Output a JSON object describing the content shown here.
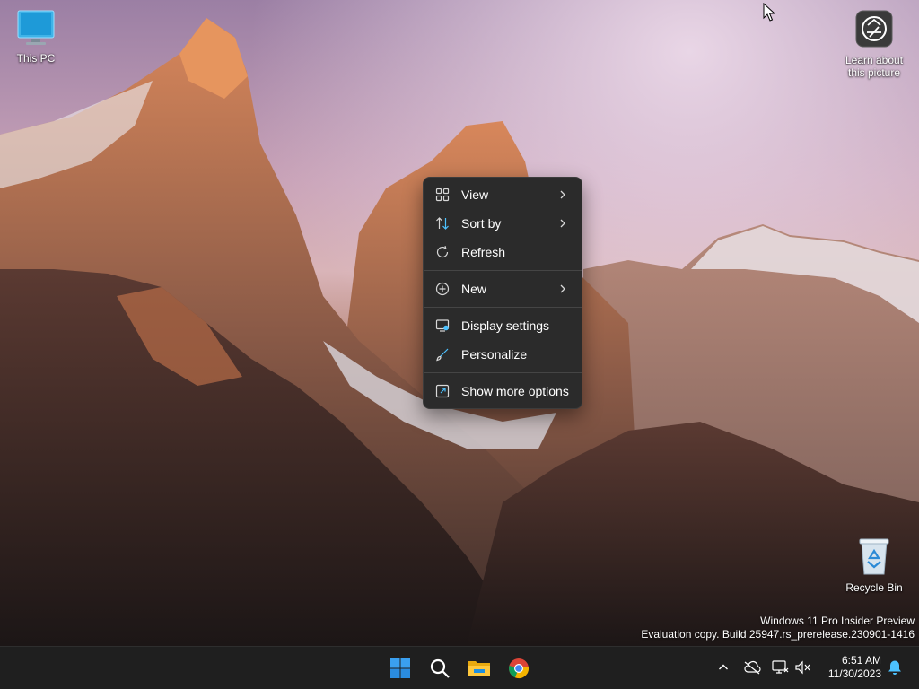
{
  "desktop": {
    "icons": [
      {
        "label": "This PC",
        "icon": "monitor-icon"
      },
      {
        "label": "Learn about this picture",
        "icon": "camera-icon"
      },
      {
        "label": "Recycle Bin",
        "icon": "recycle-bin-icon"
      }
    ],
    "watermark": {
      "line1": "Windows 11 Pro Insider Preview",
      "line2": "Evaluation copy. Build 25947.rs_prerelease.230901-1416"
    }
  },
  "context_menu": {
    "items": [
      {
        "label": "View",
        "icon": "grid-icon",
        "has_submenu": true
      },
      {
        "label": "Sort by",
        "icon": "sort-icon",
        "has_submenu": true
      },
      {
        "label": "Refresh",
        "icon": "refresh-icon",
        "has_submenu": false
      },
      {
        "label": "New",
        "icon": "plus-circle-icon",
        "has_submenu": true
      },
      {
        "label": "Display settings",
        "icon": "display-icon",
        "has_submenu": false
      },
      {
        "label": "Personalize",
        "icon": "brush-icon",
        "has_submenu": false
      },
      {
        "label": "Show more options",
        "icon": "external-icon",
        "has_submenu": false
      }
    ]
  },
  "taskbar": {
    "apps": [
      {
        "icon": "windows-start-icon"
      },
      {
        "icon": "search-icon"
      },
      {
        "icon": "file-explorer-icon"
      },
      {
        "icon": "chrome-icon"
      }
    ],
    "tray": [
      {
        "icon": "chevron-up-icon"
      },
      {
        "icon": "onedrive-offline-icon"
      },
      {
        "icon": "network-icon"
      },
      {
        "icon": "volume-muted-icon"
      }
    ],
    "clock": {
      "time": "6:51 AM",
      "date": "11/30/2023"
    }
  },
  "colors": {
    "menu_bg": "#2b2b2b",
    "taskbar_bg": "#1f1f1f",
    "accent": "#4cc2ff"
  }
}
